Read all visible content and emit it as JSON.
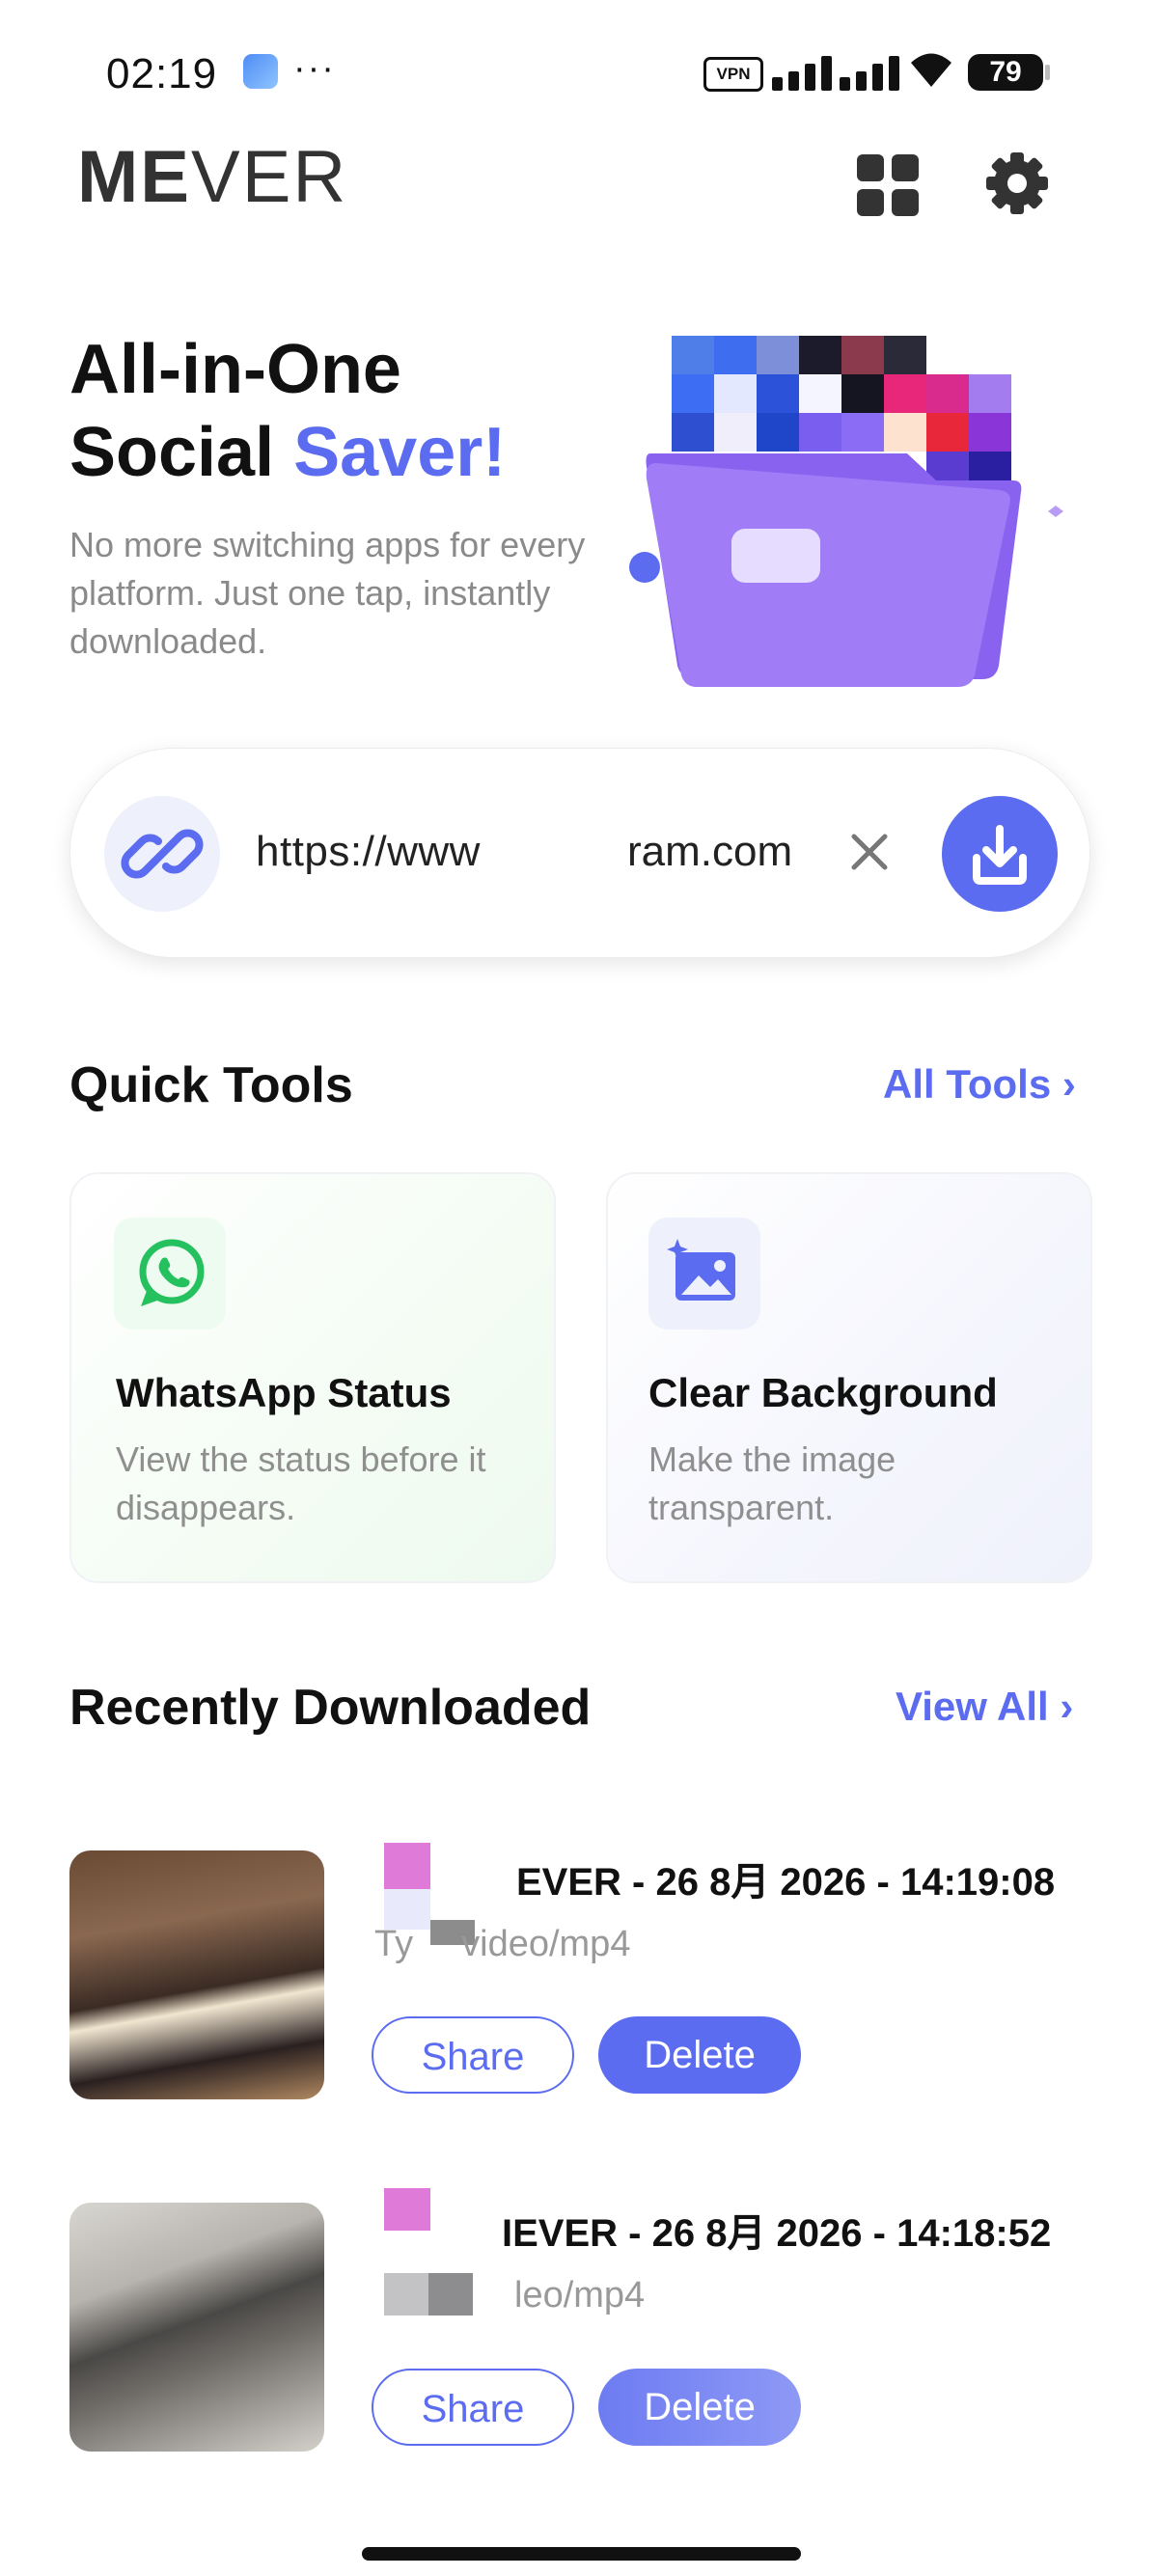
{
  "status": {
    "time": "02:19",
    "dots": "···",
    "vpn": "VPN",
    "battery": "79"
  },
  "header": {
    "logo_bold": "ME",
    "logo_light": "VER"
  },
  "hero": {
    "title_line1": "All-in-One",
    "title_line2_plain": "Social ",
    "title_line2_accent": "Saver!",
    "subtitle": "No more switching apps for every platform. Just one tap, instantly downloaded."
  },
  "url_bar": {
    "text_start": "https://www",
    "text_end": "ram.com"
  },
  "quick_tools": {
    "title": "Quick Tools",
    "link": "All Tools ›",
    "cards": [
      {
        "title": "WhatsApp Status",
        "desc": "View the status before it disappears."
      },
      {
        "title": "Clear Background",
        "desc": "Make the image transparent."
      }
    ]
  },
  "recent": {
    "title": "Recently Downloaded",
    "link": "View All ›",
    "items": [
      {
        "title": "EVER - 26 8月 2026 - 14:19:08",
        "type_prefix": "Ty",
        "type_suffix": "video/mp4",
        "share": "Share",
        "delete": "Delete"
      },
      {
        "title": "IEVER - 26 8月 2026 - 14:18:52",
        "type_prefix": "",
        "type_suffix": "leo/mp4",
        "share": "Share",
        "delete": "Delete"
      }
    ]
  },
  "colors": {
    "accent": "#5b6cf0",
    "whatsapp": "#25c15e"
  }
}
